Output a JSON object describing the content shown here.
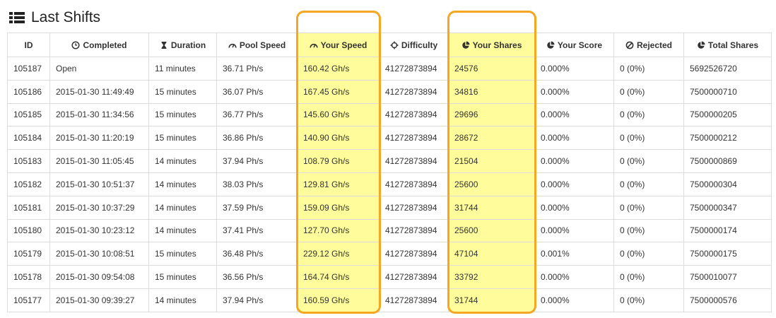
{
  "title": "Last Shifts",
  "title_icon": "list-icon",
  "highlight_color": "#f5a623",
  "highlight_fill": "#fffd9b",
  "table": {
    "columns": [
      {
        "key": "id",
        "label": "ID",
        "icon": "",
        "highlighted": false
      },
      {
        "key": "completed",
        "label": "Completed",
        "icon": "clock-icon",
        "highlighted": false
      },
      {
        "key": "duration",
        "label": "Duration",
        "icon": "hourglass-icon",
        "highlighted": false
      },
      {
        "key": "pool_speed",
        "label": "Pool Speed",
        "icon": "dashboard-icon",
        "highlighted": false
      },
      {
        "key": "your_speed",
        "label": "Your Speed",
        "icon": "dashboard-icon",
        "highlighted": true
      },
      {
        "key": "difficulty",
        "label": "Difficulty",
        "icon": "crosshairs-icon",
        "highlighted": false
      },
      {
        "key": "your_shares",
        "label": "Your Shares",
        "icon": "pie-chart-icon",
        "highlighted": true
      },
      {
        "key": "your_score",
        "label": "Your Score",
        "icon": "pie-chart-icon",
        "highlighted": false
      },
      {
        "key": "rejected",
        "label": "Rejected",
        "icon": "ban-icon",
        "highlighted": false
      },
      {
        "key": "total_shares",
        "label": "Total Shares",
        "icon": "pie-chart-icon",
        "highlighted": false
      }
    ],
    "rows": [
      [
        "105187",
        "Open",
        "11 minutes",
        "36.71 Ph/s",
        "160.42 Gh/s",
        "41272873894",
        "24576",
        "0.000%",
        "0 (0%)",
        "5692526720"
      ],
      [
        "105186",
        "2015-01-30 11:49:49",
        "15 minutes",
        "36.07 Ph/s",
        "167.45 Gh/s",
        "41272873894",
        "34816",
        "0.000%",
        "0 (0%)",
        "7500000710"
      ],
      [
        "105185",
        "2015-01-30 11:34:56",
        "15 minutes",
        "36.77 Ph/s",
        "145.60 Gh/s",
        "41272873894",
        "29696",
        "0.000%",
        "0 (0%)",
        "7500000205"
      ],
      [
        "105184",
        "2015-01-30 11:20:19",
        "15 minutes",
        "36.86 Ph/s",
        "140.90 Gh/s",
        "41272873894",
        "28672",
        "0.000%",
        "0 (0%)",
        "7500000212"
      ],
      [
        "105183",
        "2015-01-30 11:05:45",
        "14 minutes",
        "37.94 Ph/s",
        "108.79 Gh/s",
        "41272873894",
        "21504",
        "0.000%",
        "0 (0%)",
        "7500000869"
      ],
      [
        "105182",
        "2015-01-30 10:51:37",
        "14 minutes",
        "38.03 Ph/s",
        "129.81 Gh/s",
        "41272873894",
        "25600",
        "0.000%",
        "0 (0%)",
        "7500000304"
      ],
      [
        "105181",
        "2015-01-30 10:37:29",
        "14 minutes",
        "37.59 Ph/s",
        "159.09 Gh/s",
        "41272873894",
        "31744",
        "0.000%",
        "0 (0%)",
        "7500000347"
      ],
      [
        "105180",
        "2015-01-30 10:23:12",
        "14 minutes",
        "37.41 Ph/s",
        "127.70 Gh/s",
        "41272873894",
        "25600",
        "0.000%",
        "0 (0%)",
        "7500000174"
      ],
      [
        "105179",
        "2015-01-30 10:08:51",
        "15 minutes",
        "36.48 Ph/s",
        "229.12 Gh/s",
        "41272873894",
        "47104",
        "0.001%",
        "0 (0%)",
        "7500000175"
      ],
      [
        "105178",
        "2015-01-30 09:54:08",
        "15 minutes",
        "36.56 Ph/s",
        "164.74 Gh/s",
        "41272873894",
        "33792",
        "0.000%",
        "0 (0%)",
        "7500010077"
      ],
      [
        "105177",
        "2015-01-30 09:39:27",
        "14 minutes",
        "37.94 Ph/s",
        "160.59 Gh/s",
        "41272873894",
        "31744",
        "0.000%",
        "0 (0%)",
        "7500000576"
      ]
    ]
  }
}
